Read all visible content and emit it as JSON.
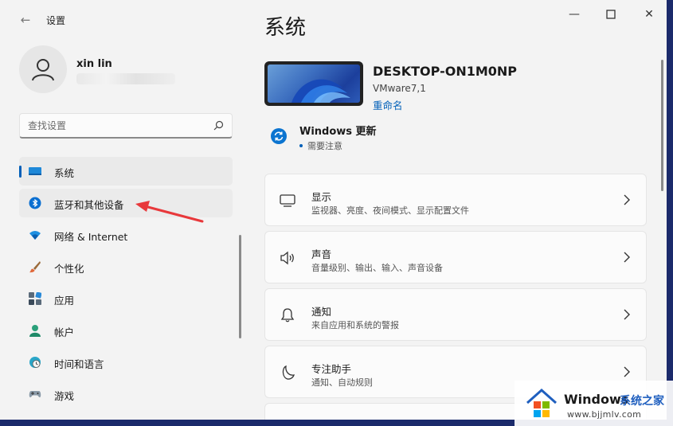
{
  "window": {
    "app_title": "设置",
    "controls": {
      "minimize": "—",
      "maximize": "☐",
      "close": "✕"
    }
  },
  "sidebar": {
    "user_name": "xin lin",
    "search_placeholder": "查找设置",
    "items": [
      {
        "label": "系统",
        "icon": "system-monitor-icon",
        "selected": true
      },
      {
        "label": "蓝牙和其他设备",
        "icon": "bluetooth-icon",
        "hovered": true
      },
      {
        "label": "网络 & Internet",
        "icon": "wifi-icon"
      },
      {
        "label": "个性化",
        "icon": "brush-icon"
      },
      {
        "label": "应用",
        "icon": "apps-icon"
      },
      {
        "label": "帐户",
        "icon": "account-icon"
      },
      {
        "label": "时间和语言",
        "icon": "globe-clock-icon"
      },
      {
        "label": "游戏",
        "icon": "gamepad-icon"
      }
    ]
  },
  "main": {
    "page_title": "系统",
    "device": {
      "name": "DESKTOP-ON1M0NP",
      "model": "VMware7,1",
      "rename_label": "重命名"
    },
    "windows_update": {
      "title": "Windows 更新",
      "status": "需要注意"
    },
    "cards": [
      {
        "title": "显示",
        "subtitle": "监视器、亮度、夜间模式、显示配置文件",
        "icon": "display-icon"
      },
      {
        "title": "声音",
        "subtitle": "音量级别、输出、输入、声音设备",
        "icon": "speaker-icon"
      },
      {
        "title": "通知",
        "subtitle": "来自应用和系统的警报",
        "icon": "bell-icon"
      },
      {
        "title": "专注助手",
        "subtitle": "通知、自动规则",
        "icon": "moon-icon"
      }
    ]
  },
  "watermark": {
    "brand": "Windows",
    "brand_cn": "系统之家",
    "url": "www.bjjmlv.com"
  },
  "colors": {
    "accent": "#005fb8",
    "annotation_arrow": "#e8383b",
    "window_frame": "#1b2a6b"
  }
}
